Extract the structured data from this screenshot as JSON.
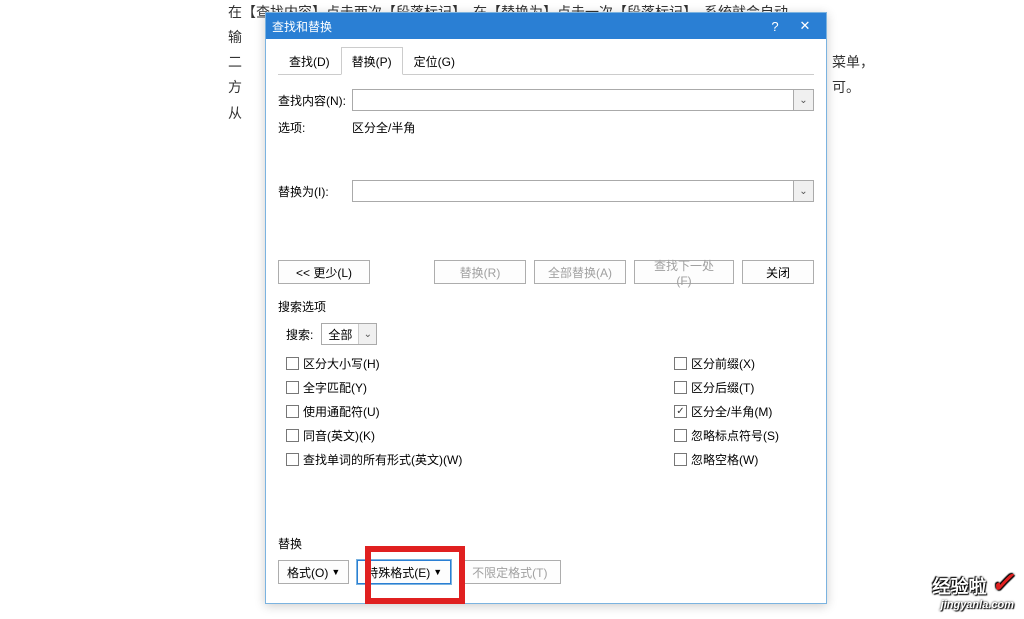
{
  "background": {
    "topline": "在【查找内容】点击两次【段落标记】，在【替换为】点击一次【段落标记】，系统就会自动",
    "leftcol": [
      "输",
      "二",
      "方",
      "从"
    ],
    "rightcol": [
      "菜单，",
      "可。"
    ]
  },
  "dialog": {
    "title": "查找和替换",
    "tabs": {
      "find": "查找(D)",
      "replace": "替换(P)",
      "goto": "定位(G)"
    },
    "findLabel": "查找内容(N):",
    "optionsLabel": "选项:",
    "optionsValue": "区分全/半角",
    "replaceLabel": "替换为(I):",
    "buttons": {
      "less": "<< 更少(L)",
      "replace": "替换(R)",
      "replaceAll": "全部替换(A)",
      "findNext": "查找下一处(F)",
      "close": "关闭"
    },
    "searchOptionsTitle": "搜索选项",
    "searchLabel": "搜索:",
    "searchValue": "全部",
    "checks": {
      "matchCase": "区分大小写(H)",
      "wholeWord": "全字匹配(Y)",
      "wildcards": "使用通配符(U)",
      "soundsLike": "同音(英文)(K)",
      "wordForms": "查找单词的所有形式(英文)(W)",
      "prefix": "区分前缀(X)",
      "suffix": "区分后缀(T)",
      "fullHalf": "区分全/半角(M)",
      "ignorePunct": "忽略标点符号(S)",
      "ignoreSpace": "忽略空格(W)"
    },
    "replaceSection": {
      "title": "替换",
      "format": "格式(O)",
      "special": "特殊格式(E)",
      "noFormat": "不限定格式(T)"
    }
  },
  "watermark": {
    "brand": "经验啦",
    "url": "jingyanla.com"
  }
}
